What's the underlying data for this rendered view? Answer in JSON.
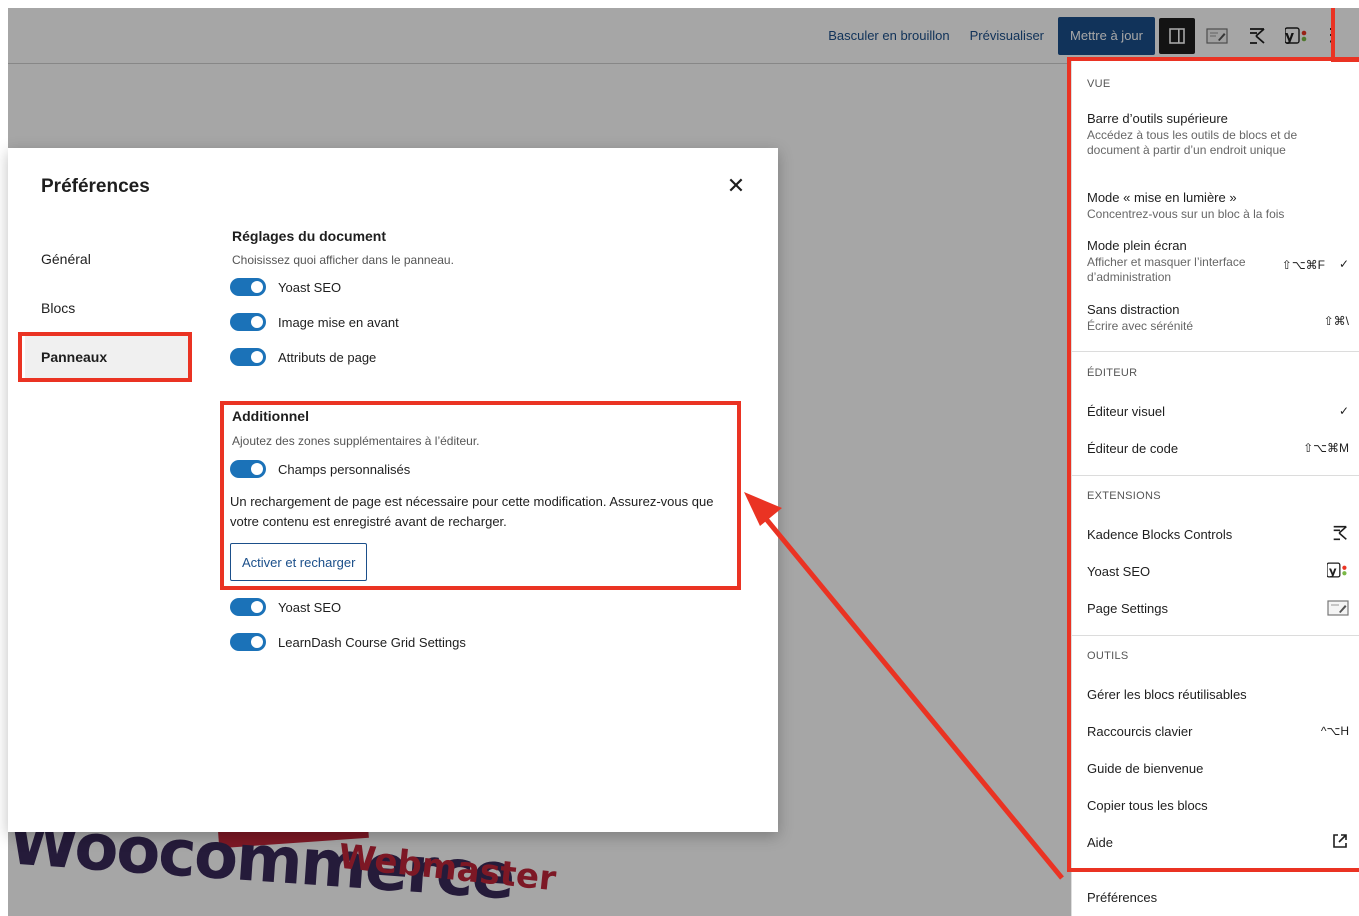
{
  "topbar": {
    "draft_label": "Basculer en brouillon",
    "preview_label": "Prévisualiser",
    "update_label": "Mettre à jour",
    "icons": [
      "sidebar-icon",
      "page-settings-icon",
      "kadence-icon",
      "yoast-icon",
      "more-options-icon"
    ]
  },
  "modal": {
    "title": "Préférences",
    "nav": [
      {
        "label": "Général"
      },
      {
        "label": "Blocs"
      },
      {
        "label": "Panneaux"
      }
    ],
    "document_settings": {
      "title": "Réglages du document",
      "description": "Choisissez quoi afficher dans le panneau.",
      "toggles": [
        {
          "label": "Yoast SEO",
          "on": true
        },
        {
          "label": "Image mise en avant",
          "on": true
        },
        {
          "label": "Attributs de page",
          "on": true
        }
      ]
    },
    "additional": {
      "title": "Additionnel",
      "description": "Ajoutez des zones supplémentaires à l’éditeur.",
      "toggle_label": "Champs personnalisés",
      "reload_note": "Un rechargement de page est nécessaire pour cette modification. Assurez-vous que votre contenu est enregistré avant de recharger.",
      "reload_button": "Activer et recharger",
      "extra_toggles": [
        {
          "label": "Yoast SEO",
          "on": true
        },
        {
          "label": "LearnDash Course Grid Settings",
          "on": true
        }
      ]
    }
  },
  "menu": {
    "view": {
      "group": "VUE",
      "items": [
        {
          "label": "Barre d’outils supérieure",
          "desc": "Accédez à tous les outils de blocs et de document à partir d’un endroit unique"
        },
        {
          "label": "Mode « mise en lumière »",
          "desc": "Concentrez-vous sur un bloc à la fois"
        },
        {
          "label": "Mode plein écran",
          "desc": "Afficher et masquer l’interface d’administration",
          "shortcut": "⇧⌥⌘F",
          "check": "✓"
        },
        {
          "label": "Sans distraction",
          "desc": "Écrire avec sérénité",
          "shortcut": "⇧⌘\\"
        }
      ]
    },
    "editor": {
      "group": "ÉDITEUR",
      "items": [
        {
          "label": "Éditeur visuel",
          "check": "✓"
        },
        {
          "label": "Éditeur de code",
          "shortcut": "⇧⌥⌘M"
        }
      ]
    },
    "extensions": {
      "group": "EXTENSIONS",
      "items": [
        {
          "label": "Kadence Blocks Controls"
        },
        {
          "label": "Yoast SEO"
        },
        {
          "label": "Page Settings"
        }
      ]
    },
    "tools": {
      "group": "OUTILS",
      "items": [
        {
          "label": "Gérer les blocs réutilisables"
        },
        {
          "label": "Raccourcis clavier",
          "shortcut": "^⌥H"
        },
        {
          "label": "Guide de bienvenue"
        },
        {
          "label": "Copier tous les blocs"
        },
        {
          "label": "Aide"
        }
      ]
    },
    "preferences_label": "Préférences"
  },
  "background": {
    "word_woo": "Woocommerce",
    "word_webmaster": "Webmaster"
  },
  "colors": {
    "primary": "#1b4f8a",
    "toggle_on": "#1b72b8",
    "annotation": "#ea3323"
  }
}
